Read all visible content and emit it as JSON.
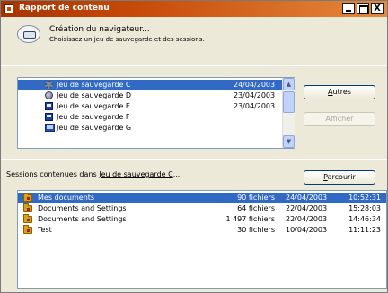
{
  "window": {
    "title": "Rapport de contenu",
    "controls": {
      "minimize": "_",
      "maximize": "□",
      "close": "X"
    }
  },
  "header": {
    "title": "Création du navigateur...",
    "subtitle": "Choisissez un jeu de sauvegarde et des sessions."
  },
  "backup_sets": {
    "items": [
      {
        "name": "Jeu de sauvegarde C",
        "date": "24/04/2003",
        "icon": "gear-icon",
        "selected": true
      },
      {
        "name": "Jeu de sauvegarde D",
        "date": "23/04/2003",
        "icon": "network-icon",
        "selected": false
      },
      {
        "name": "Jeu de sauvegarde E",
        "date": "23/04/2003",
        "icon": "disk-icon",
        "selected": false
      },
      {
        "name": "Jeu de sauvegarde F",
        "date": "",
        "icon": "disk-icon",
        "selected": false
      },
      {
        "name": "Jeu de sauvegarde G",
        "date": "",
        "icon": "computer-icon",
        "selected": false
      }
    ],
    "buttons": {
      "others": "Autres",
      "others_key": "A",
      "others_rest": "utres",
      "display": "Afficher"
    }
  },
  "sessions": {
    "label_prefix": "Sessions contenues dans ",
    "label_link": "Jeu de sauvegarde C",
    "label_suffix": "...",
    "browse_button": "Parcourir",
    "browse_key": "P",
    "browse_rest": "arcourir",
    "rows": [
      {
        "name": "Mes documents",
        "files": "90 fichiers",
        "date": "24/04/2003",
        "time": "10:52:31",
        "selected": true
      },
      {
        "name": "Documents and Settings",
        "files": "64 fichiers",
        "date": "22/04/2003",
        "time": "15:28:03",
        "selected": false
      },
      {
        "name": "Documents and Settings",
        "files": "1 497 fichiers",
        "date": "22/04/2003",
        "time": "14:46:34",
        "selected": false
      },
      {
        "name": "Test",
        "files": "30 fichiers",
        "date": "10/04/2003",
        "time": "11:11:23",
        "selected": false
      }
    ]
  },
  "colors": {
    "titlebar": "#c74a08",
    "selection": "#316ac5",
    "window_bg": "#ece9d8"
  }
}
